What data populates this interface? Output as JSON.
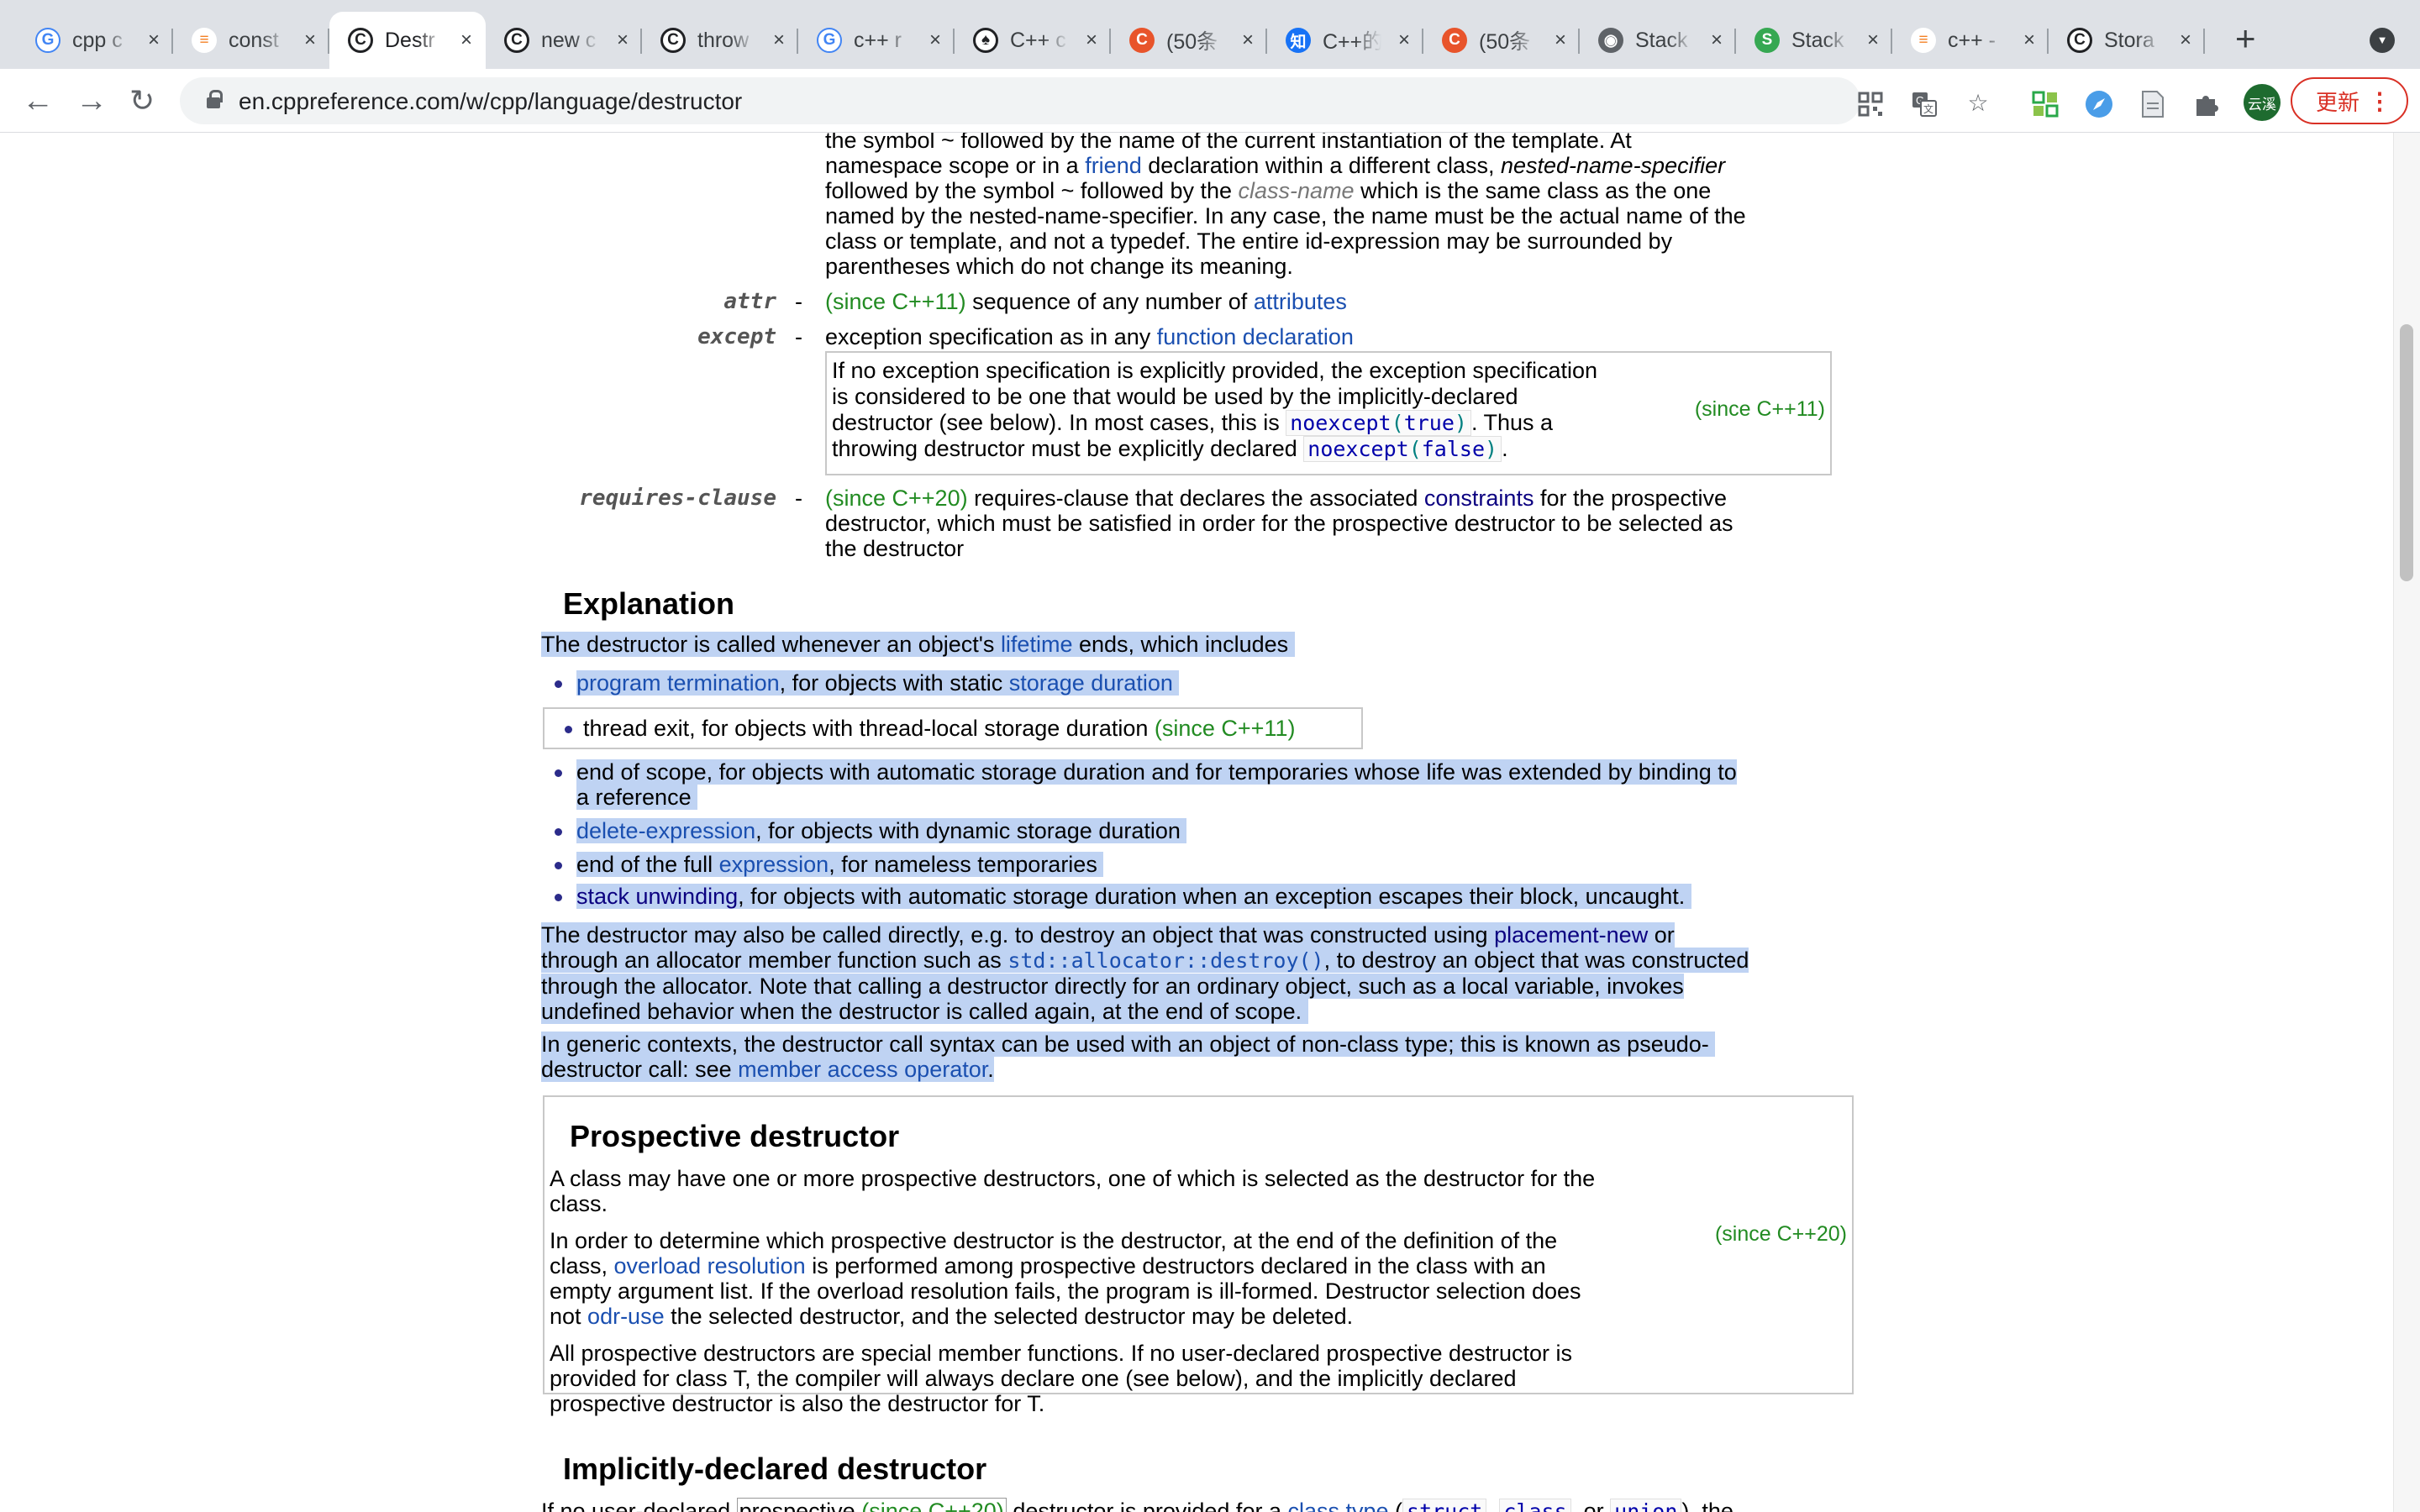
{
  "browser": {
    "tabs": [
      {
        "title": "cpp c",
        "icon": "google-icon",
        "color": "#4285f4"
      },
      {
        "title": "const",
        "icon": "stackoverflow-icon",
        "color": "#f48024"
      },
      {
        "title": "Destr",
        "icon": "cppreference-icon",
        "color": "#202124",
        "active": true
      },
      {
        "title": "new c",
        "icon": "cppreference-icon",
        "color": "#202124"
      },
      {
        "title": "throw",
        "icon": "cppreference-icon",
        "color": "#202124"
      },
      {
        "title": "c++ r",
        "icon": "google-icon",
        "color": "#4285f4"
      },
      {
        "title": "C++ c",
        "icon": "bird-icon",
        "color": "#202124"
      },
      {
        "title": "(50条",
        "icon": "csdn-icon",
        "color": "#e8542b"
      },
      {
        "title": "C++的",
        "icon": "zhihu-icon",
        "color": "#1772f6"
      },
      {
        "title": "(50条",
        "icon": "csdn-icon",
        "color": "#e8542b"
      },
      {
        "title": "Stack",
        "icon": "globe-icon",
        "color": "#5f6368"
      },
      {
        "title": "Stack",
        "icon": "stackexchange-icon",
        "color": "#36a852"
      },
      {
        "title": "c++ -",
        "icon": "stackoverflow-icon",
        "color": "#f48024"
      },
      {
        "title": "Stora",
        "icon": "cppreference-icon",
        "color": "#202124"
      }
    ],
    "close_glyph": "×",
    "new_tab_glyph": "+",
    "url": "en.cppreference.com/w/cpp/language/destructor",
    "profile_text": "云溪",
    "update_label": "更新",
    "accent": "#d93025"
  },
  "content": {
    "top_desc": {
      "l1": "the symbol ~ followed by the name of the current instantiation of the template. At",
      "l2a": "namespace scope or in a ",
      "l2_link": "friend",
      "l2b": " declaration within a different class, ",
      "l2_em": "nested-name-specifier",
      "l3a": "followed by the symbol ~ followed by the ",
      "l3_em": "class-name",
      "l3b": " which is the same class as the one",
      "l4": "named by the nested-name-specifier. In any case, the name must be the actual name of the",
      "l5": "class or template, and not a typedef. The entire id-expression may be surrounded by",
      "l6": "parentheses which do not change its meaning."
    },
    "attr": {
      "term": "attr",
      "dash": "-",
      "since": "(since C++11)",
      "text": " sequence of any number of ",
      "link": "attributes"
    },
    "except": {
      "term": "except",
      "dash": "-",
      "text": "exception specification as in any ",
      "link": "function declaration",
      "box_l1": "If no exception specification is explicitly provided, the exception specification",
      "box_l2": "is considered to be one that would be used by the implicitly-declared",
      "box_l3a": "destructor (see below). In most cases, this is ",
      "box_code1a": "noexcept",
      "box_code1b": "(",
      "box_code1c": "true",
      "box_code1d": ")",
      "box_l3b": ". Thus a",
      "box_l4a": "throwing destructor must be explicitly declared ",
      "box_code2a": "noexcept",
      "box_code2b": "(",
      "box_code2c": "false",
      "box_code2d": ")",
      "box_l4b": ".",
      "since": "(since C++11)"
    },
    "requires": {
      "term": "requires-clause",
      "dash": "-",
      "since": "(since C++20)",
      "l1a": " requires-clause that declares the associated ",
      "l1_link": "constraints",
      "l1b": " for the prospective",
      "l2": "destructor, which must be satisfied in order for the prospective destructor to be selected as",
      "l3": "the destructor"
    },
    "explanation": {
      "heading": "Explanation",
      "intro_a": "The destructor is called whenever an object's ",
      "intro_link": "lifetime",
      "intro_b": " ends, which includes",
      "b1_link": "program termination",
      "b1_a": ", for objects with static ",
      "b1_link2": "storage duration",
      "b2": "thread exit, for objects with thread-local storage duration ",
      "b2_since": "(since C++11)",
      "b3_l1": "end of scope, for objects with automatic storage duration and for temporaries whose life was extended by binding to",
      "b3_l2": "a reference",
      "b4_link": "delete-expression",
      "b4_a": ", for objects with dynamic storage duration",
      "b5_a": "end of the full ",
      "b5_link": "expression",
      "b5_b": ", for nameless temporaries",
      "b6_link": "stack unwinding",
      "b6_a": ", for objects with automatic storage duration when an exception escapes their block, uncaught.",
      "p2_l1a": "The destructor may also be called directly, e.g. to destroy an object that was constructed using ",
      "p2_l1_link": "placement-new",
      "p2_l1b": " or",
      "p2_l2a": "through an allocator member function such as ",
      "p2_l2_code": "std::allocator::destroy()",
      "p2_l2b": ", to destroy an object that was constructed",
      "p2_l3": "through the allocator. Note that calling a destructor directly for an ordinary object, such as a local variable, invokes",
      "p2_l4": "undefined behavior when the destructor is called again, at the end of scope.",
      "p3_l1": "In generic contexts, the destructor call syntax can be used with an object of non-class type; this is known as pseudo-",
      "p3_l2a": "destructor call: see ",
      "p3_link": "member access operator",
      "p3_l2b": "."
    },
    "prospective": {
      "heading": "Prospective destructor",
      "p1_l1": "A class may have one or more prospective destructors, one of which is selected as the destructor for the",
      "p1_l2": "class.",
      "p2_l1": "In order to determine which prospective destructor is the destructor, at the end of the definition of the",
      "p2_l2a": "class, ",
      "p2_link": "overload resolution",
      "p2_l2b": " is performed among prospective destructors declared in the class with an",
      "p2_l3": "empty argument list. If the overload resolution fails, the program is ill-formed. Destructor selection does",
      "p2_l4a": "not ",
      "p2_link2": "odr-use",
      "p2_l4b": " the selected destructor, and the selected destructor may be deleted.",
      "p3_l1": "All prospective destructors are special member functions. If no user-declared prospective destructor is",
      "p3_l2": "provided for class T, the compiler will always declare one (see below), and the implicitly declared",
      "p3_l3": "prospective destructor is also the destructor for T.",
      "since": "(since C++20)"
    },
    "implicit": {
      "heading": "Implicitly-declared destructor",
      "l1a": "If no user-declared ",
      "l1_code1": "prospective",
      "l1_since": "(since C++20)",
      "l1b": " destructor is provided for a ",
      "l1_link": "class type",
      "l1c": " (",
      "l1_code2": "struct",
      "l1d": ", ",
      "l1_code3": "class",
      "l1e": ", or ",
      "l1_code4": "union",
      "l1f": "), the"
    }
  }
}
